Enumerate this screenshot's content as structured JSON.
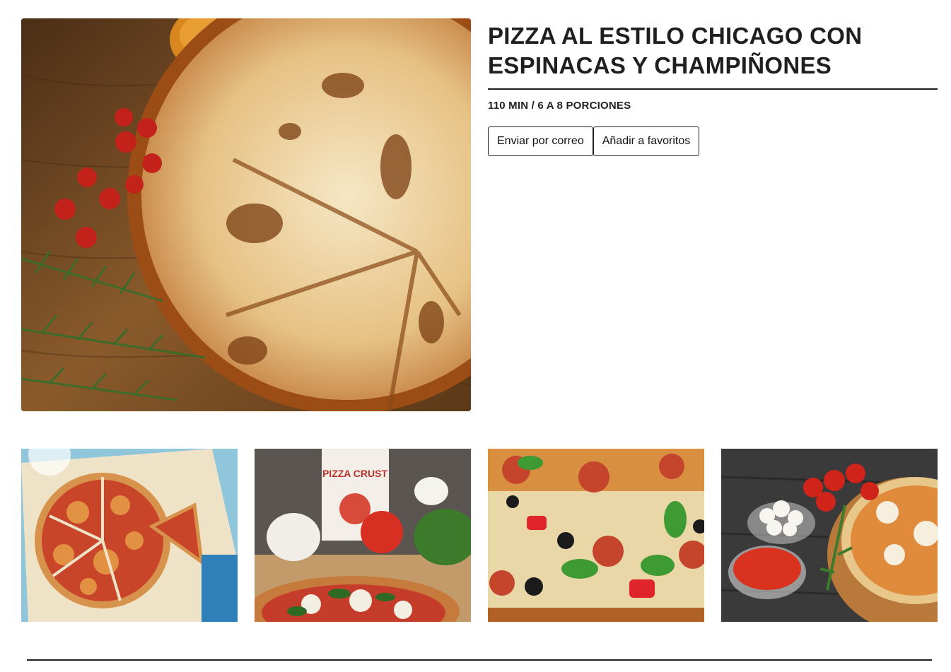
{
  "recipe": {
    "title": "PIZZA AL ESTILO CHICAGO CON ESPINACAS Y CHAMPIÑONES",
    "meta": "110 MIN / 6 A 8 PORCIONES"
  },
  "actions": {
    "email_label": "Enviar por correo",
    "favorite_label": "Añadir a favoritos"
  },
  "gallery": {
    "thumb2_package_text": "PIZZA CRUST"
  }
}
